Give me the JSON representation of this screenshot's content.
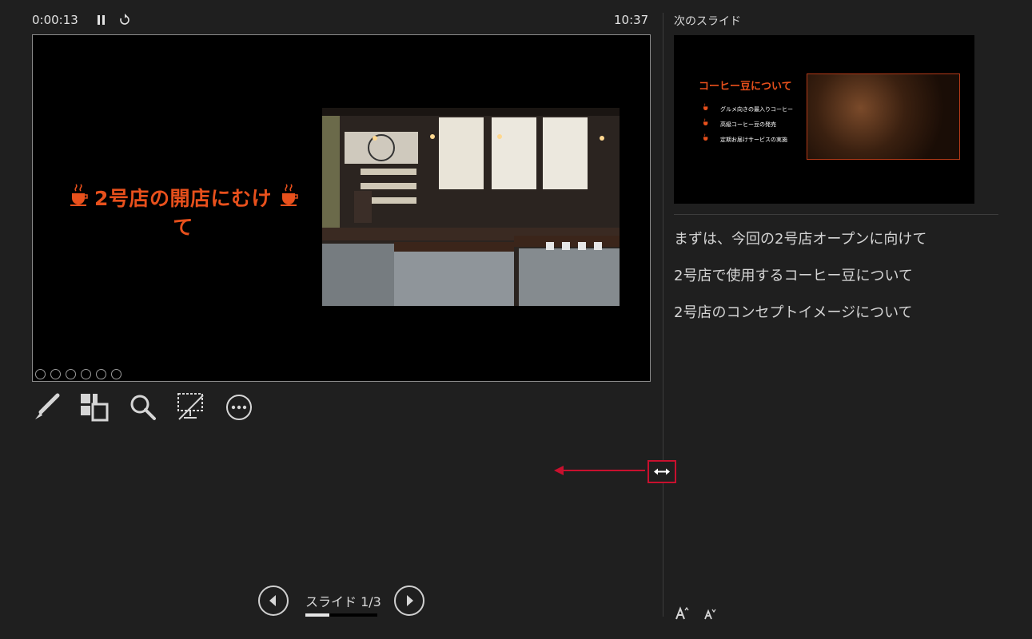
{
  "topbar": {
    "elapsed_time": "0:00:13",
    "pause_icon": "pause-icon",
    "restart_icon": "restart-icon",
    "clock": "10:37"
  },
  "current_slide": {
    "title": "2号店の開店にむけて",
    "title_color": "#e8501c",
    "decor_icon": "coffee-cup-icon",
    "photo": "cafe-interior-photo",
    "mini_toolbar": [
      "previous-icon",
      "next-icon",
      "pen-icon",
      "grid-icon",
      "zoom-icon",
      "more-icon"
    ]
  },
  "toolbar": {
    "tools": [
      "pen-tool-icon",
      "see-all-slides-icon",
      "zoom-icon",
      "black-screen-icon",
      "more-options-icon"
    ]
  },
  "next_slide": {
    "label": "次のスライド",
    "title": "コーヒー豆について",
    "bullets": [
      "グルメ向きの最入りコーヒー",
      "高級コーヒー豆の発売",
      "定期お届けサービスの実施"
    ],
    "photo": "coffee-beans-photo"
  },
  "notes": [
    "まずは、今回の2号店オープンに向けて",
    "2号店で使用するコーヒー豆について",
    "2号店のコンセプトイメージについて"
  ],
  "navigation": {
    "slide_counter": "スライド 1/3",
    "progress_fraction": 0.33
  },
  "font_controls": [
    "increase-font-icon",
    "decrease-font-icon"
  ],
  "resize_handle": "resize-horizontal-icon",
  "accent_red": "#c8102e"
}
